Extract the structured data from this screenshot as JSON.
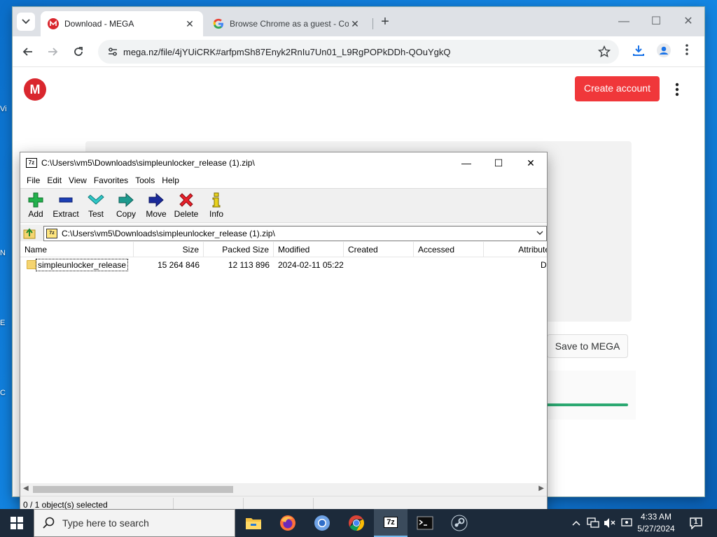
{
  "browser": {
    "tabs": [
      {
        "title": "Download - MEGA",
        "close": "✕"
      },
      {
        "title": "Browse Chrome as a guest - Co",
        "close": "✕"
      }
    ],
    "new_tab": "+",
    "url": "mega.nz/file/4jYUiCRK#arfpmSh87Enyk2RnIu7Un01_L9RgPOPkDDh-QOuYgkQ",
    "window_controls": {
      "minimize": "—",
      "maximize": "☐",
      "close": "✕"
    }
  },
  "mega": {
    "logo_letter": "M",
    "create_account": "Create account",
    "save_to_mega": "Save to MEGA",
    "progress_fraction": 1.0,
    "accent": "#f0373a",
    "progress_color": "#2ba871"
  },
  "sevenzip": {
    "title": "C:\\Users\\vm5\\Downloads\\simpleunlocker_release (1).zip\\",
    "app_icon": "7z",
    "window_controls": {
      "minimize": "—",
      "maximize": "☐",
      "close": "✕"
    },
    "menu": [
      "File",
      "Edit",
      "View",
      "Favorites",
      "Tools",
      "Help"
    ],
    "toolbar": [
      {
        "label": "Add",
        "icon": "plus-icon"
      },
      {
        "label": "Extract",
        "icon": "minus-icon"
      },
      {
        "label": "Test",
        "icon": "check-icon"
      },
      {
        "label": "Copy",
        "icon": "copy-arrow-icon"
      },
      {
        "label": "Move",
        "icon": "move-arrow-icon"
      },
      {
        "label": "Delete",
        "icon": "delete-x-icon"
      },
      {
        "label": "Info",
        "icon": "info-icon"
      }
    ],
    "address": "C:\\Users\\vm5\\Downloads\\simpleunlocker_release (1).zip\\",
    "columns": [
      "Name",
      "Size",
      "Packed Size",
      "Modified",
      "Created",
      "Accessed",
      "Attribute"
    ],
    "rows": [
      {
        "name": "simpleunlocker_release",
        "size": "15 264 846",
        "packed": "12 113 896",
        "modified": "2024-02-11 05:22",
        "created": "",
        "accessed": "",
        "attributes": "D"
      }
    ],
    "status": "0 / 1 object(s) selected"
  },
  "taskbar": {
    "search_placeholder": "Type here to search",
    "apps": [
      "file-explorer-icon",
      "firefox-icon",
      "chromium-icon",
      "chrome-icon",
      "7zip-icon",
      "terminal-icon",
      "steam-icon"
    ],
    "sevenzip_label": "7z",
    "time": "4:33 AM",
    "date": "5/27/2024",
    "notification_count": "1"
  },
  "desktop": {
    "fragments": [
      "Vi",
      "N",
      "E",
      "C"
    ]
  }
}
